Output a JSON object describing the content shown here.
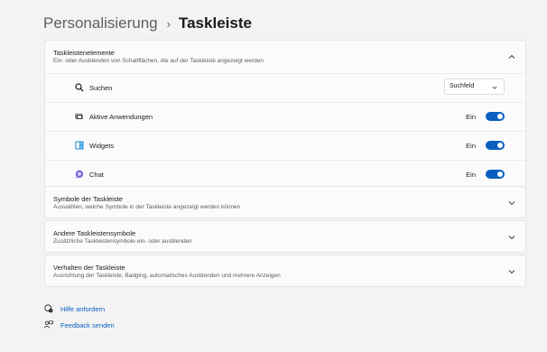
{
  "breadcrumb": {
    "parent": "Personalisierung",
    "separator": "›",
    "current": "Taskleiste"
  },
  "sections": [
    {
      "title": "Taskleistenelemente",
      "description": "Ein- oder Ausblenden von Schaltflächen, die auf der Taskleiste angezeigt werden",
      "expanded": true,
      "items": [
        {
          "label": "Suchen",
          "icon": "search-icon",
          "control": "dropdown",
          "value": "Suchfeld"
        },
        {
          "label": "Aktive Anwendungen",
          "icon": "task-view-icon",
          "control": "toggle",
          "state_label": "Ein",
          "on": true
        },
        {
          "label": "Widgets",
          "icon": "widgets-icon",
          "control": "toggle",
          "state_label": "Ein",
          "on": true
        },
        {
          "label": "Chat",
          "icon": "chat-icon",
          "control": "toggle",
          "state_label": "Ein",
          "on": true
        }
      ]
    },
    {
      "title": "Symbole der Taskleiste",
      "description": "Auswählen, welche Symbole in der Taskleiste angezeigt werden können",
      "expanded": false
    },
    {
      "title": "Andere Taskleistensymbole",
      "description": "Zusätzliche Taskleistensymbole ein- oder ausblenden",
      "expanded": false
    },
    {
      "title": "Verhalten der Taskleiste",
      "description": "Ausrichtung der Taskleiste, Badging, automatisches Ausblenden und mehrere Anzeigen",
      "expanded": false
    }
  ],
  "footer_links": [
    {
      "label": "Hilfe anfordern",
      "icon": "help-icon"
    },
    {
      "label": "Feedback senden",
      "icon": "feedback-icon"
    }
  ],
  "colors": {
    "accent": "#0a5ebf",
    "background": "#f3f3f3",
    "card": "#fbfbfb"
  }
}
